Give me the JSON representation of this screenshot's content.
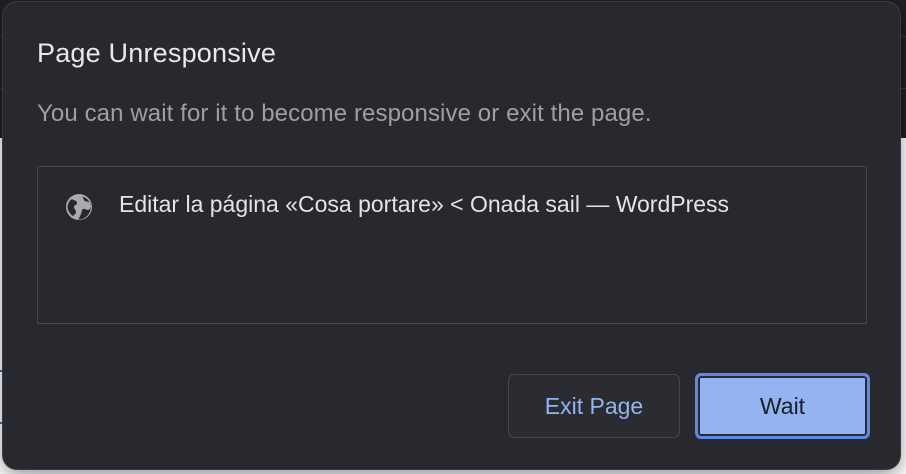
{
  "dialog": {
    "title": "Page Unresponsive",
    "message": "You can wait for it to become responsive or exit the page.",
    "pages": [
      {
        "icon": "globe-icon",
        "label": "Editar la página «Cosa portare» < Onada sail — WordPress"
      }
    ],
    "buttons": {
      "exit_label": "Exit Page",
      "wait_label": "Wait"
    }
  },
  "colors": {
    "dialog_bg": "#28292e",
    "accent": "#94b3f1",
    "link_text": "#93b4f0"
  }
}
